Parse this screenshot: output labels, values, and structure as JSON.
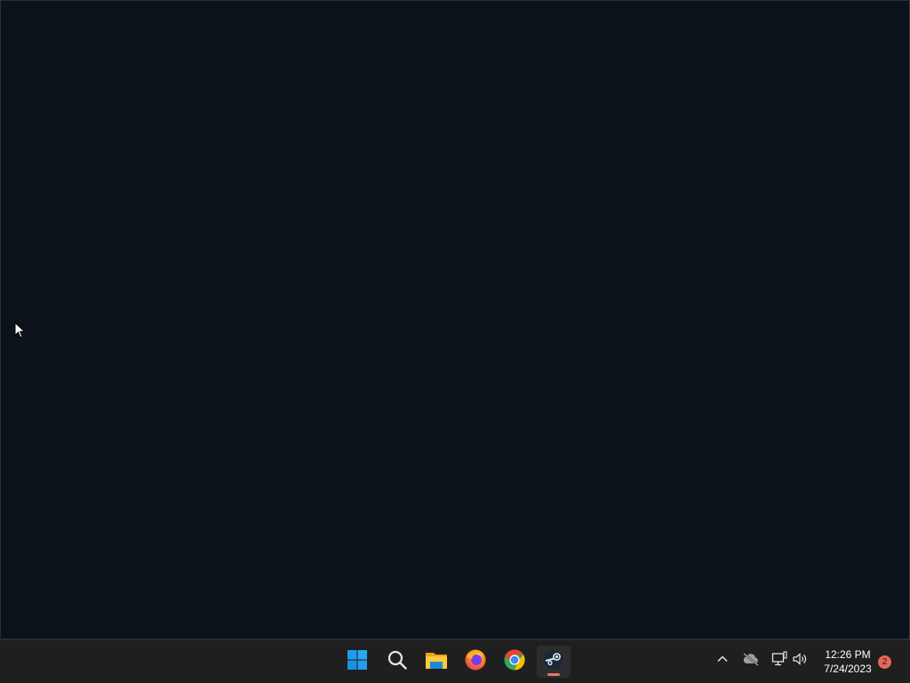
{
  "taskbar": {
    "icons": {
      "start": "windows-start-icon",
      "search": "search-icon",
      "file_explorer": "file-explorer-icon",
      "firefox": "firefox-icon",
      "chrome": "chrome-icon",
      "steam": "steam-icon"
    },
    "active_app": "steam"
  },
  "tray": {
    "icons": [
      "chevron-up-icon",
      "cloud-offline-icon",
      "network-icon",
      "volume-icon"
    ]
  },
  "clock": {
    "time": "12:26 PM",
    "date": "7/24/2023"
  },
  "notifications": {
    "count": "2"
  },
  "colors": {
    "window_bg": "#0b121a",
    "taskbar_bg": "#1f1f1f",
    "accent_indicator": "#e4786a",
    "badge": "#e8675b"
  }
}
